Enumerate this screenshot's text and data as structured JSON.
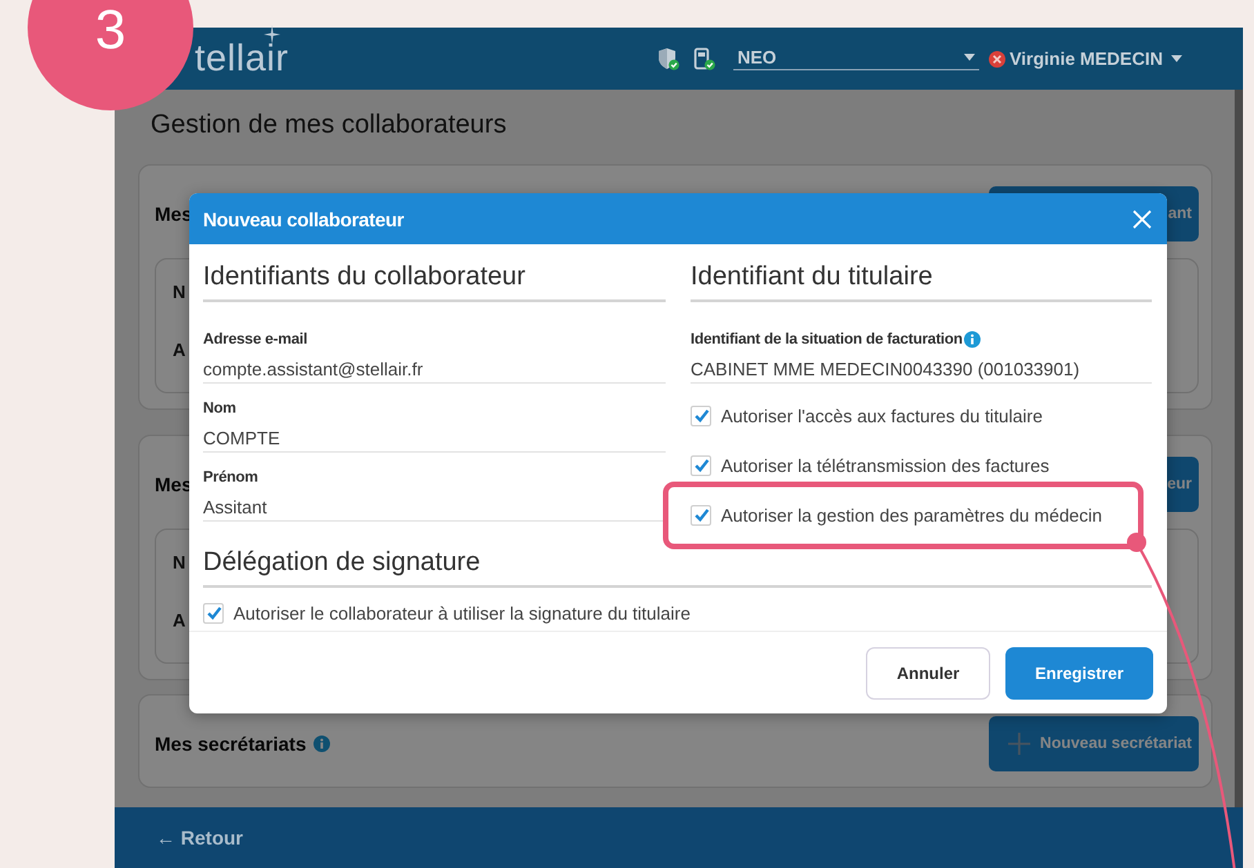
{
  "step_badge": "3",
  "app": {
    "logo": "tellair",
    "header": {
      "account": "NEO",
      "user": "Virginie MEDECIN"
    },
    "page_title": "Gestion de mes collaborateurs",
    "sections": [
      {
        "title": "Mes",
        "button": {
          "label": "ant"
        },
        "cards": [
          {
            "line_1": "N",
            "line_2": "A"
          }
        ]
      },
      {
        "title": "Mes",
        "button": {
          "label": "eur"
        },
        "cards": [
          {
            "line_1": "N",
            "line_2": "A"
          }
        ]
      },
      {
        "title": "Mes secrétariats",
        "info": true,
        "button": {
          "label": "Nouveau secrétariat",
          "kind": "add"
        }
      }
    ],
    "footer": {
      "back_link": "← Retour"
    }
  },
  "dialog": {
    "title": "Nouveau collaborateur",
    "left": {
      "heading": "Identifiants du collaborateur",
      "fields": [
        {
          "label": "Adresse e-mail",
          "value": "compte.assistant@stellair.fr"
        },
        {
          "label": "Nom",
          "value": "COMPTE"
        },
        {
          "label": "Prénom",
          "value": "Assitant"
        }
      ]
    },
    "right": {
      "heading": "Identifiant du titulaire",
      "field": {
        "label": "Identifiant de la situation de facturation",
        "info": true,
        "value": "CABINET MME MEDECIN0043390 (001033901)"
      },
      "checkboxes": [
        {
          "label": "Autoriser l'accès aux factures du titulaire",
          "checked": true,
          "highlighted": false
        },
        {
          "label": "Autoriser la télétransmission des factures",
          "checked": true,
          "highlighted": false
        },
        {
          "label": "Autoriser la gestion des paramètres du médecin",
          "checked": true,
          "highlighted": true
        }
      ]
    },
    "delegation": {
      "heading": "Délégation de signature",
      "checkbox": {
        "label": "Autoriser le collaborateur à utiliser la signature du titulaire",
        "checked": true
      }
    },
    "buttons": [
      {
        "label": "Annuler",
        "kind": "secondary"
      },
      {
        "label": "Enregistrer",
        "kind": "primary"
      }
    ]
  }
}
